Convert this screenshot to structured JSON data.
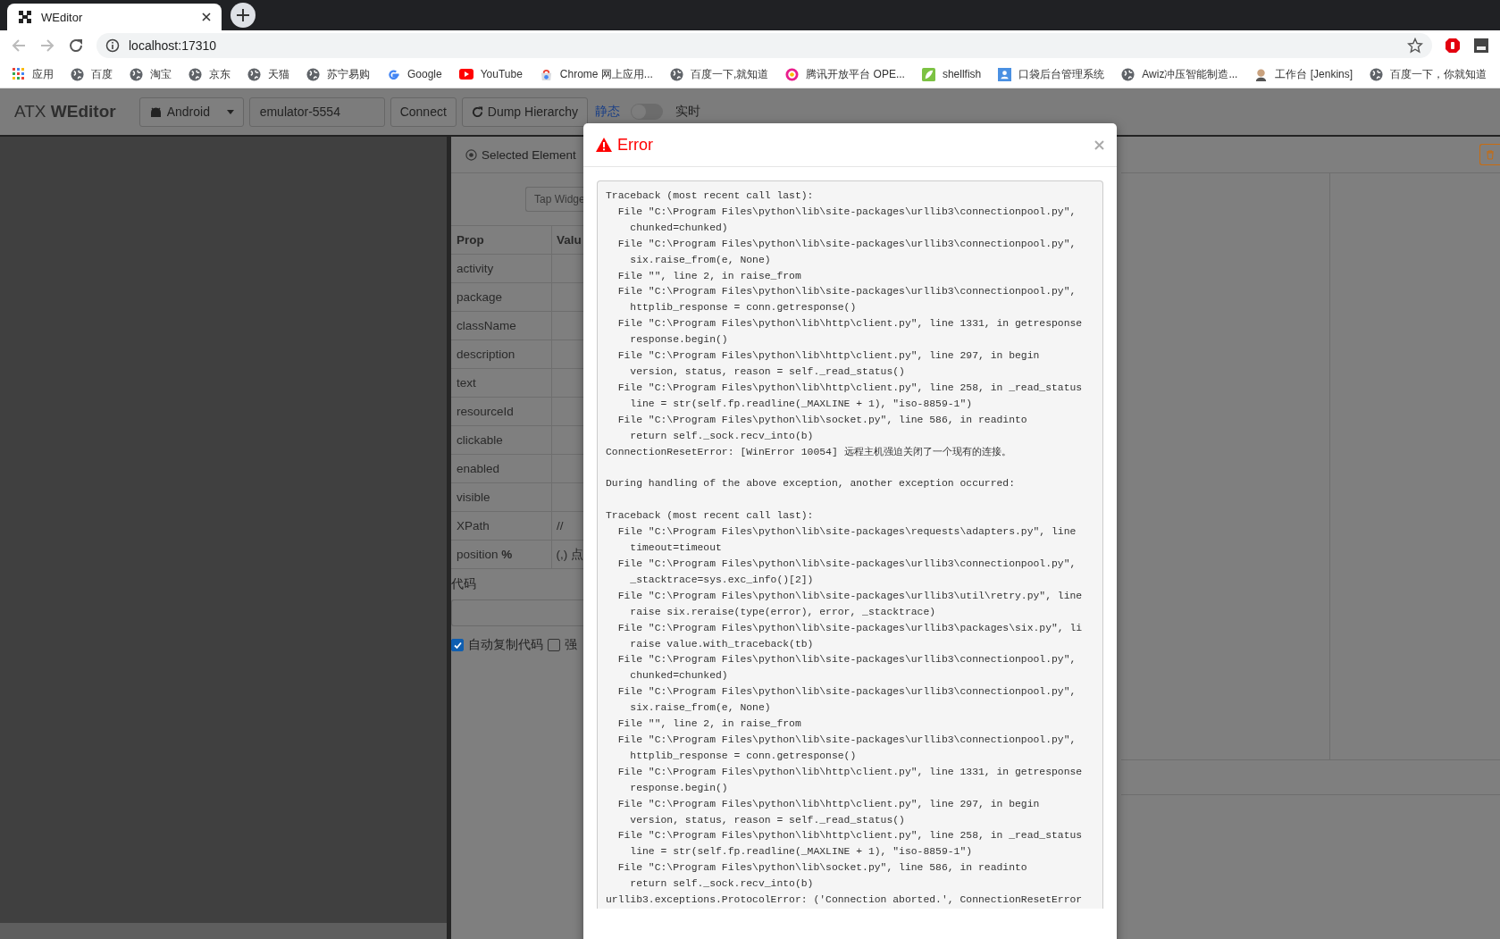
{
  "browser": {
    "tab": {
      "title": "WEditor"
    },
    "address": "localhost:17310",
    "bookmarks": [
      {
        "kind": "apps",
        "label": "应用"
      },
      {
        "kind": "globe",
        "label": "百度"
      },
      {
        "kind": "globe",
        "label": "淘宝"
      },
      {
        "kind": "globe",
        "label": "京东"
      },
      {
        "kind": "globe",
        "label": "天猫"
      },
      {
        "kind": "globe",
        "label": "苏宁易购"
      },
      {
        "kind": "google",
        "label": "Google"
      },
      {
        "kind": "youtube",
        "label": "YouTube"
      },
      {
        "kind": "store",
        "label": "Chrome 网上应用..."
      },
      {
        "kind": "globe",
        "label": "百度一下,就知道"
      },
      {
        "kind": "tencent",
        "label": "腾讯开放平台 OPE..."
      },
      {
        "kind": "shellfish",
        "label": "shellfish"
      },
      {
        "kind": "person",
        "label": "口袋后台管理系统"
      },
      {
        "kind": "globe",
        "label": "Awiz冲压智能制造..."
      },
      {
        "kind": "avatar",
        "label": "工作台 [Jenkins]"
      },
      {
        "kind": "globe",
        "label": "百度一下，你就知道"
      }
    ]
  },
  "navbar": {
    "brand": "ATX **WEditor**",
    "platform": "Android",
    "device": "emulator-5554",
    "connect": "Connect",
    "dump": "Dump Hierarchy",
    "static_label": "静态",
    "live": {
      "on": false
    },
    "live_label": "实时"
  },
  "inspector": {
    "title": "Selected Element",
    "tap_button": "Tap Widge",
    "columns": [
      "Prop",
      "Valu"
    ],
    "rows": [
      {
        "prop": "activity"
      },
      {
        "prop": "package"
      },
      {
        "prop": "className"
      },
      {
        "prop": "description"
      },
      {
        "prop": "text"
      },
      {
        "prop": "resourceId"
      },
      {
        "prop": "clickable"
      },
      {
        "prop": "enabled"
      },
      {
        "prop": "visible"
      },
      {
        "prop": "XPath",
        "value": "//"
      },
      {
        "prop": "position **%**",
        "value": "(,) 点"
      }
    ],
    "code_label": "代码",
    "options": [
      {
        "label": "自动复制代码",
        "checked": true
      },
      {
        "label": "强",
        "checked": false
      }
    ]
  },
  "dialog": {
    "title": "Error",
    "blocks": [
      [
        "Traceback (most recent call last):",
        "  File \"C:\\Program Files\\python\\lib\\site-packages\\urllib3\\connectionpool.py\",",
        "    chunked=chunked)",
        "  File \"C:\\Program Files\\python\\lib\\site-packages\\urllib3\\connectionpool.py\",",
        "    six.raise_from(e, None)",
        "  File \"\", line 2, in raise_from",
        "  File \"C:\\Program Files\\python\\lib\\site-packages\\urllib3\\connectionpool.py\",",
        "    httplib_response = conn.getresponse()",
        "  File \"C:\\Program Files\\python\\lib\\http\\client.py\", line 1331, in getresponse",
        "    response.begin()",
        "  File \"C:\\Program Files\\python\\lib\\http\\client.py\", line 297, in begin",
        "    version, status, reason = self._read_status()",
        "  File \"C:\\Program Files\\python\\lib\\http\\client.py\", line 258, in _read_status",
        "    line = str(self.fp.readline(_MAXLINE + 1), \"iso-8859-1\")",
        "  File \"C:\\Program Files\\python\\lib\\socket.py\", line 586, in readinto",
        "    return self._sock.recv_into(b)",
        "ConnectionResetError: [WinError 10054] 远程主机强迫关闭了一个现有的连接。"
      ],
      [
        "During handling of the above exception, another exception occurred:"
      ],
      [
        "Traceback (most recent call last):",
        "  File \"C:\\Program Files\\python\\lib\\site-packages\\requests\\adapters.py\", line",
        "    timeout=timeout",
        "  File \"C:\\Program Files\\python\\lib\\site-packages\\urllib3\\connectionpool.py\",",
        "    _stacktrace=sys.exc_info()[2])",
        "  File \"C:\\Program Files\\python\\lib\\site-packages\\urllib3\\util\\retry.py\", line",
        "    raise six.reraise(type(error), error, _stacktrace)",
        "  File \"C:\\Program Files\\python\\lib\\site-packages\\urllib3\\packages\\six.py\", li",
        "    raise value.with_traceback(tb)",
        "  File \"C:\\Program Files\\python\\lib\\site-packages\\urllib3\\connectionpool.py\",",
        "    chunked=chunked)",
        "  File \"C:\\Program Files\\python\\lib\\site-packages\\urllib3\\connectionpool.py\",",
        "    six.raise_from(e, None)",
        "  File \"\", line 2, in raise_from",
        "  File \"C:\\Program Files\\python\\lib\\site-packages\\urllib3\\connectionpool.py\",",
        "    httplib_response = conn.getresponse()",
        "  File \"C:\\Program Files\\python\\lib\\http\\client.py\", line 1331, in getresponse",
        "    response.begin()",
        "  File \"C:\\Program Files\\python\\lib\\http\\client.py\", line 297, in begin",
        "    version, status, reason = self._read_status()",
        "  File \"C:\\Program Files\\python\\lib\\http\\client.py\", line 258, in _read_status",
        "    line = str(self.fp.readline(_MAXLINE + 1), \"iso-8859-1\")",
        "  File \"C:\\Program Files\\python\\lib\\socket.py\", line 586, in readinto",
        "    return self._sock.recv_into(b)",
        "urllib3.exceptions.ProtocolError: ('Connection aborted.', ConnectionResetError"
      ]
    ]
  }
}
